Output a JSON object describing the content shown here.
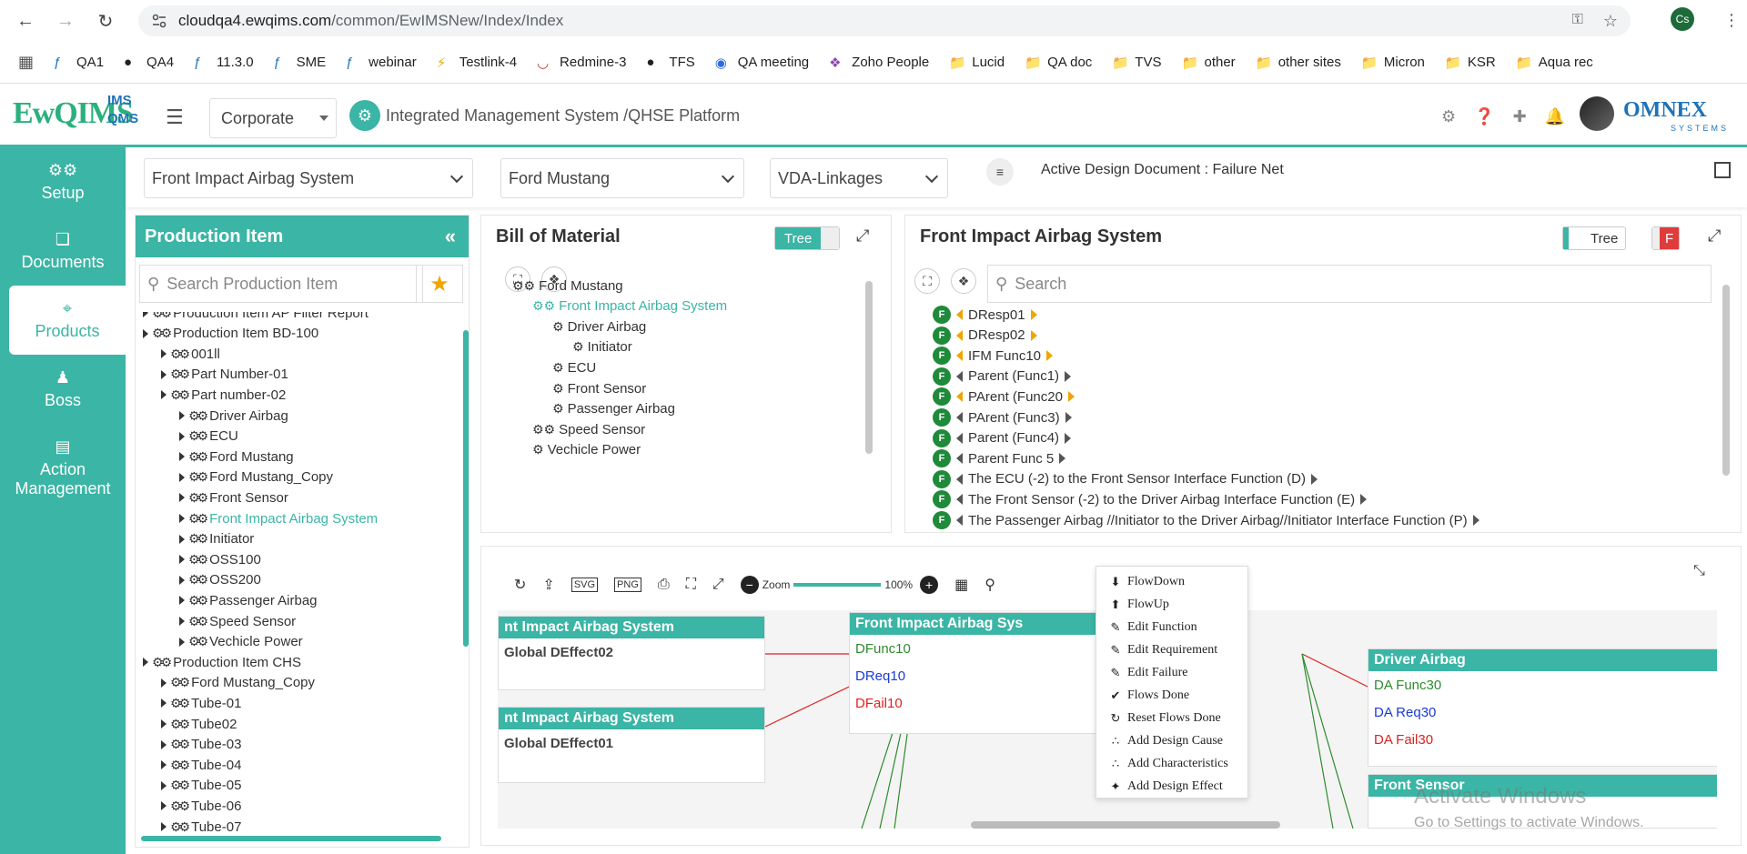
{
  "browser": {
    "url_host": "cloudqa4.ewqims.com",
    "url_path": "/common/EwIMSNew/Index/Index",
    "profile": "Cs"
  },
  "bookmarks": [
    "QA1",
    "QA4",
    "11.3.0",
    "SME",
    "webinar",
    "Testlink-4",
    "Redmine-3",
    "TFS",
    "QA meeting",
    "Zoho People",
    "Lucid",
    "QA doc",
    "TVS",
    "other",
    "other sites",
    "Micron",
    "KSR",
    "Aqua rec"
  ],
  "header": {
    "logo": "EwQIMS",
    "logo_ims": "IMS",
    "logo_qms": "QMS",
    "org_select": "Corporate",
    "title": "Integrated Management System /QHSE Platform",
    "brand": "OMNEX",
    "brand_sub": "SYSTEMS"
  },
  "nav": [
    {
      "label": "Setup",
      "icon": "setup-icon"
    },
    {
      "label": "Documents",
      "icon": "documents-icon"
    },
    {
      "label": "Products",
      "icon": "products-icon",
      "active": true
    },
    {
      "label": "Boss",
      "icon": "boss-icon"
    },
    {
      "label": "Action Management",
      "icon": "action-icon"
    }
  ],
  "filters": {
    "system": "Front Impact Airbag System",
    "product": "Ford Mustang",
    "linkage": "VDA-Linkages",
    "active_doc": "Active Design Document : Failure Net"
  },
  "production": {
    "title": "Production Item",
    "search_placeholder": "Search Production Item",
    "items": [
      {
        "label": "Production Item AP Filter Report",
        "level": 0
      },
      {
        "label": "Production Item BD-100",
        "level": 0
      },
      {
        "label": "001ll",
        "level": 1
      },
      {
        "label": "Part Number-01",
        "level": 1
      },
      {
        "label": "Part number-02",
        "level": 1
      },
      {
        "label": "Driver Airbag",
        "level": 2
      },
      {
        "label": "ECU",
        "level": 2
      },
      {
        "label": "Ford Mustang",
        "level": 2
      },
      {
        "label": "Ford Mustang_Copy",
        "level": 2
      },
      {
        "label": "Front Sensor",
        "level": 2
      },
      {
        "label": "Front Impact Airbag System",
        "level": 2,
        "selected": true
      },
      {
        "label": "Initiator",
        "level": 2
      },
      {
        "label": "OSS100",
        "level": 2
      },
      {
        "label": "OSS200",
        "level": 2
      },
      {
        "label": "Passenger Airbag",
        "level": 2
      },
      {
        "label": "Speed Sensor",
        "level": 2
      },
      {
        "label": "Vechicle Power",
        "level": 2
      },
      {
        "label": "Production Item CHS",
        "level": 0
      },
      {
        "label": "Ford Mustang_Copy",
        "level": 1
      },
      {
        "label": "Tube-01",
        "level": 1
      },
      {
        "label": "Tube02",
        "level": 1
      },
      {
        "label": "Tube-03",
        "level": 1
      },
      {
        "label": "Tube-04",
        "level": 1
      },
      {
        "label": "Tube-05",
        "level": 1
      },
      {
        "label": "Tube-06",
        "level": 1
      },
      {
        "label": "Tube-07",
        "level": 1
      }
    ]
  },
  "bom": {
    "title": "Bill of Material",
    "toggle": "Tree",
    "items": [
      {
        "label": "Ford Mustang",
        "level": 0
      },
      {
        "label": "Front Impact Airbag System",
        "level": 1,
        "selected": true
      },
      {
        "label": "Driver Airbag",
        "level": 2
      },
      {
        "label": "Initiator",
        "level": 3
      },
      {
        "label": "ECU",
        "level": 2
      },
      {
        "label": "Front Sensor",
        "level": 2
      },
      {
        "label": "Passenger Airbag",
        "level": 2
      },
      {
        "label": "Speed Sensor",
        "level": 1
      },
      {
        "label": "Vechicle Power",
        "level": 1
      }
    ]
  },
  "fis": {
    "title": "Front Impact Airbag System",
    "toggle": "Tree",
    "toggle_f": "F",
    "search_placeholder": "Search",
    "items": [
      {
        "label": "DResp01",
        "orange": true
      },
      {
        "label": "DResp02",
        "orange": true
      },
      {
        "label": "IFM Func10",
        "orange": true
      },
      {
        "label": "Parent (Func1)",
        "orange": false
      },
      {
        "label": "PArent (Func20",
        "orange": true
      },
      {
        "label": "PArent (Func3)",
        "orange": false
      },
      {
        "label": "Parent (Func4)",
        "orange": false
      },
      {
        "label": "Parent Func 5",
        "orange": false
      },
      {
        "label": "The ECU (-2) to the Front Sensor Interface Function (D)",
        "orange": false
      },
      {
        "label": "The Front Sensor (-2) to the Driver Airbag Interface Function (E)",
        "orange": false
      },
      {
        "label": "The Passenger Airbag //Initiator to the Driver Airbag//Initiator Interface Function (P)",
        "orange": false
      }
    ]
  },
  "diagram": {
    "zoom_label": "Zoom",
    "zoom_value": "100%",
    "cards": [
      {
        "title": "nt Impact Airbag System",
        "lines": [
          {
            "text": "Global DEffect02",
            "color": "#444"
          }
        ]
      },
      {
        "title": "nt Impact Airbag System",
        "lines": [
          {
            "text": "Global DEffect01",
            "color": "#444"
          }
        ]
      },
      {
        "title": "Front Impact Airbag Sys",
        "lines": [
          {
            "text": "DFunc10",
            "color": "#2e8b2e"
          },
          {
            "text": "DReq10",
            "color": "#1a3ad6"
          },
          {
            "text": "DFail10",
            "color": "#e02020"
          }
        ]
      },
      {
        "title": "Driver Airbag",
        "lines": [
          {
            "text": "DA Func30",
            "color": "#2e8b2e"
          },
          {
            "text": "DA Req30",
            "color": "#1a3ad6"
          },
          {
            "text": "DA Fail30",
            "color": "#e02020"
          }
        ]
      },
      {
        "title": "Front  Sensor",
        "lines": []
      }
    ],
    "context_menu": [
      {
        "label": "FlowDown",
        "icon": "flowdown-icon"
      },
      {
        "label": "FlowUp",
        "icon": "flowup-icon"
      },
      {
        "label": "Edit Function",
        "icon": "pencil-icon"
      },
      {
        "label": "Edit Requirement",
        "icon": "pencil-icon"
      },
      {
        "label": "Edit Failure",
        "icon": "pencil-icon"
      },
      {
        "label": "Flows Done",
        "icon": "check-icon"
      },
      {
        "label": "Reset Flows Done",
        "icon": "reset-icon"
      },
      {
        "label": "Add Design Cause",
        "icon": "cause-icon"
      },
      {
        "label": "Add Characteristics",
        "icon": "char-icon"
      },
      {
        "label": "Add Design Effect",
        "icon": "effect-icon"
      }
    ]
  },
  "watermark": {
    "line1": "Activate Windows",
    "line2": "Go to Settings to activate Windows."
  }
}
